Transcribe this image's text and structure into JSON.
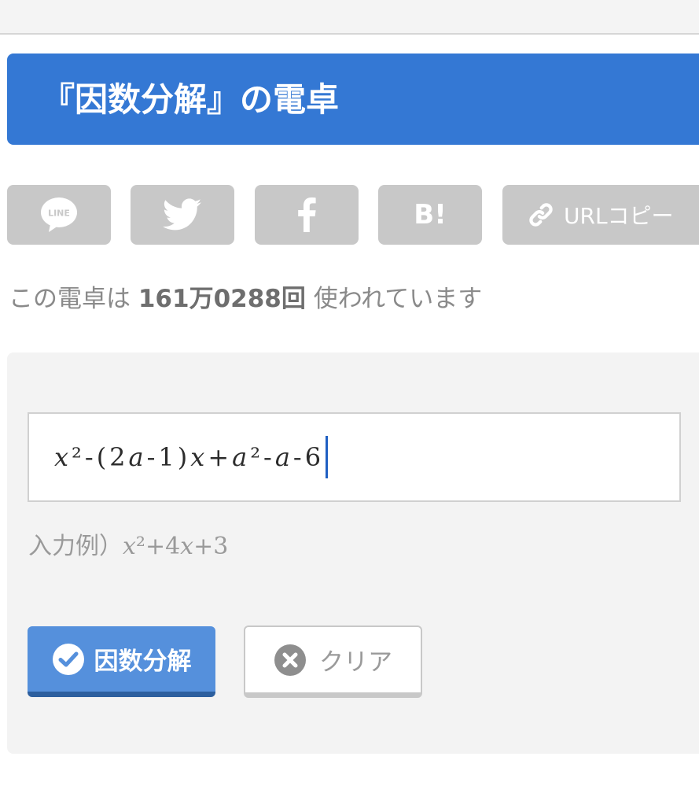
{
  "header": {
    "title": "『因数分解』の電卓"
  },
  "share": {
    "buttons": [
      {
        "name": "LINE",
        "icon": "line-icon",
        "label": "LINE"
      },
      {
        "name": "Twitter",
        "icon": "twitter-icon"
      },
      {
        "name": "Facebook",
        "icon": "facebook-icon"
      },
      {
        "name": "Hatena Bookmark",
        "icon": "hatena-bookmark-icon",
        "label": "B!"
      },
      {
        "name": "URL copy",
        "icon": "link-icon",
        "label": "URLコピー"
      }
    ]
  },
  "usage": {
    "prefix": "この電卓は",
    "count": "161万0288回",
    "suffix": "使われています"
  },
  "calculator": {
    "expression": "𝑥²-(2𝑎-1)𝑥+𝑎²-𝑎-6",
    "example_prefix": "入力例）",
    "example_expression": "𝑥²+4𝑥+3",
    "factor_label": "因数分解",
    "clear_label": "クリア"
  },
  "colors": {
    "accent": "#3478d4",
    "primary_button": "#5590dc",
    "share_button": "#c8c8c8",
    "panel": "#f3f3f3"
  }
}
